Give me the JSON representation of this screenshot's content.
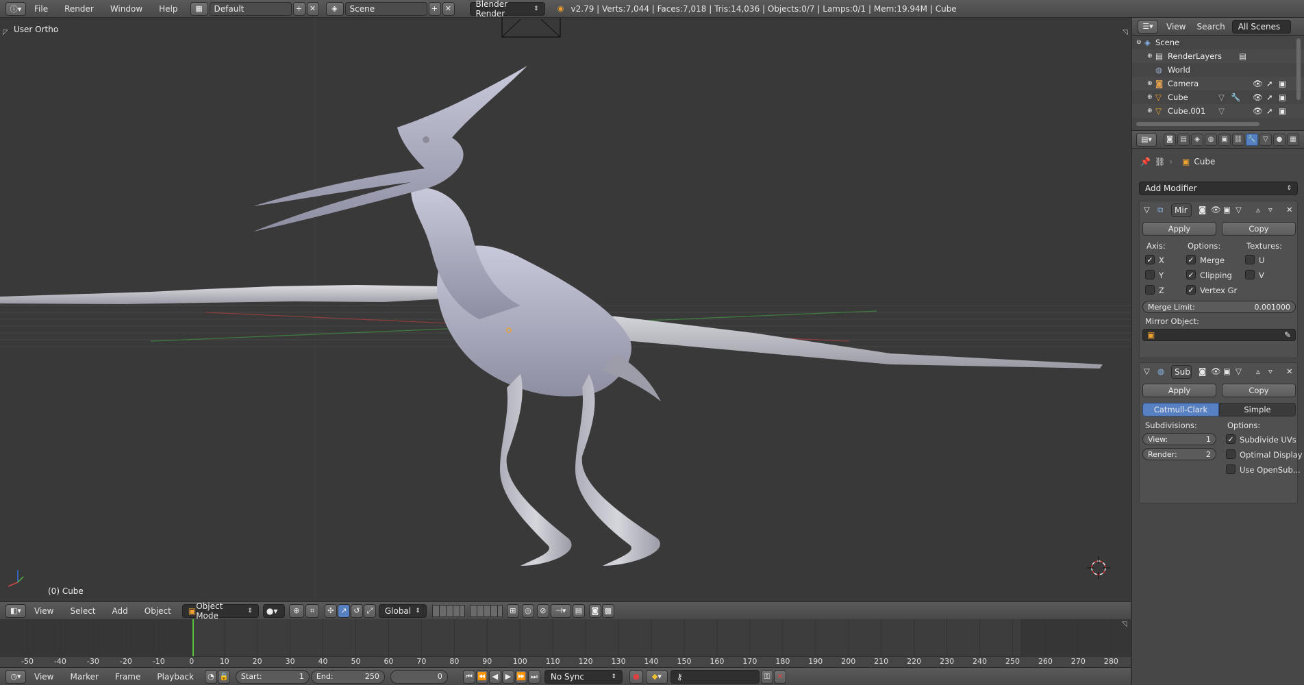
{
  "topbar": {
    "menus": [
      "File",
      "Render",
      "Window",
      "Help"
    ],
    "layout_name": "Default",
    "scene_name": "Scene",
    "render_engine": "Blender Render",
    "stats": "v2.79 | Verts:7,044 | Faces:7,018 | Tris:14,036 | Objects:0/7 | Lamps:0/1 | Mem:19.94M | Cube"
  },
  "viewport": {
    "view_label": "User Ortho",
    "active_object_label": "(0) Cube"
  },
  "view3d_header": {
    "menus": [
      "View",
      "Select",
      "Add",
      "Object"
    ],
    "mode": "Object Mode",
    "orientation": "Global"
  },
  "timeline": {
    "ticks": [
      "-50",
      "-40",
      "-30",
      "-20",
      "-10",
      "0",
      "10",
      "20",
      "30",
      "40",
      "50",
      "60",
      "70",
      "80",
      "90",
      "100",
      "110",
      "120",
      "130",
      "140",
      "150",
      "160",
      "170",
      "180",
      "190",
      "200",
      "210",
      "220",
      "230",
      "240",
      "250",
      "260",
      "270",
      "280"
    ],
    "current_frame": 0
  },
  "timeline_header": {
    "menus": [
      "View",
      "Marker",
      "Frame",
      "Playback"
    ],
    "start_label": "Start:",
    "start_value": "1",
    "end_label": "End:",
    "end_value": "250",
    "frame_value": "0",
    "sync": "No Sync"
  },
  "outliner": {
    "menus": [
      "View",
      "Search"
    ],
    "filter": "All Scenes",
    "items": [
      {
        "label": "Scene",
        "icon": "scene-icon"
      },
      {
        "label": "RenderLayers",
        "icon": "renderlayers-icon"
      },
      {
        "label": "World",
        "icon": "world-icon"
      },
      {
        "label": "Camera",
        "icon": "camera-icon"
      },
      {
        "label": "Cube",
        "icon": "mesh-icon"
      },
      {
        "label": "Cube.001",
        "icon": "mesh-icon"
      }
    ]
  },
  "properties": {
    "context_object": "Cube",
    "add_modifier_label": "Add Modifier",
    "mirror": {
      "name": "Mir",
      "apply": "Apply",
      "copy": "Copy",
      "axis_label": "Axis:",
      "options_label": "Options:",
      "textures_label": "Textures:",
      "x": "X",
      "y": "Y",
      "z": "Z",
      "merge": "Merge",
      "clipping": "Clipping",
      "vertex_groups": "Vertex Gr",
      "u": "U",
      "v": "V",
      "merge_limit_label": "Merge Limit:",
      "merge_limit_value": "0.001000",
      "mirror_object_label": "Mirror Object:"
    },
    "subsurf": {
      "name": "Sub",
      "apply": "Apply",
      "copy": "Copy",
      "catmull_clark": "Catmull-Clark",
      "simple": "Simple",
      "subdivisions_label": "Subdivisions:",
      "options_label": "Options:",
      "view_label": "View:",
      "view_value": "1",
      "render_label": "Render:",
      "render_value": "2",
      "subdivide_uvs": "Subdivide UVs",
      "optimal_display": "Optimal Display",
      "use_opensubdiv": "Use OpenSub..."
    }
  },
  "colors": {
    "accent": "#5680c2",
    "viewport_bg": "#393939",
    "current_frame_line": "#59c23a"
  }
}
